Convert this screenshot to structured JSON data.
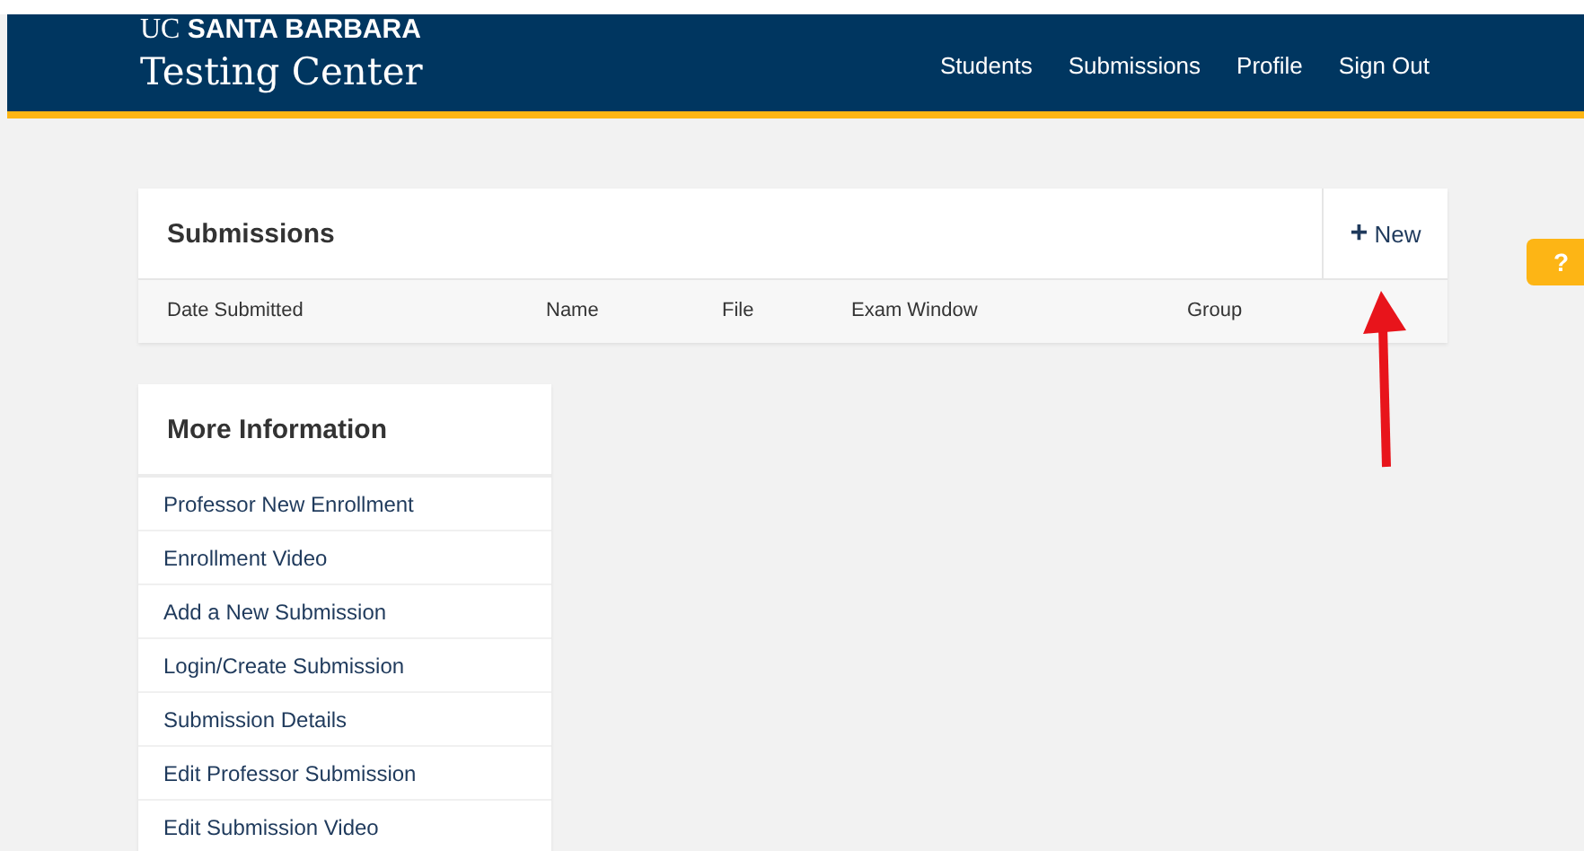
{
  "header": {
    "logo_prefix": "UC",
    "logo_name": "SANTA BARBARA",
    "site_title": "Testing Center",
    "nav": [
      "Students",
      "Submissions",
      "Profile",
      "Sign Out"
    ]
  },
  "submissions": {
    "title": "Submissions",
    "new_button": {
      "icon": "+",
      "label": "New"
    },
    "columns": [
      "Date Submitted",
      "Name",
      "File",
      "Exam Window",
      "Group"
    ]
  },
  "more_information": {
    "title": "More Information",
    "links": [
      "Professor New Enrollment",
      "Enrollment Video",
      "Add a New Submission",
      "Login/Create Submission",
      "Submission Details",
      "Edit Professor Submission",
      "Edit Submission Video"
    ]
  },
  "help_tab": {
    "label": "?"
  }
}
